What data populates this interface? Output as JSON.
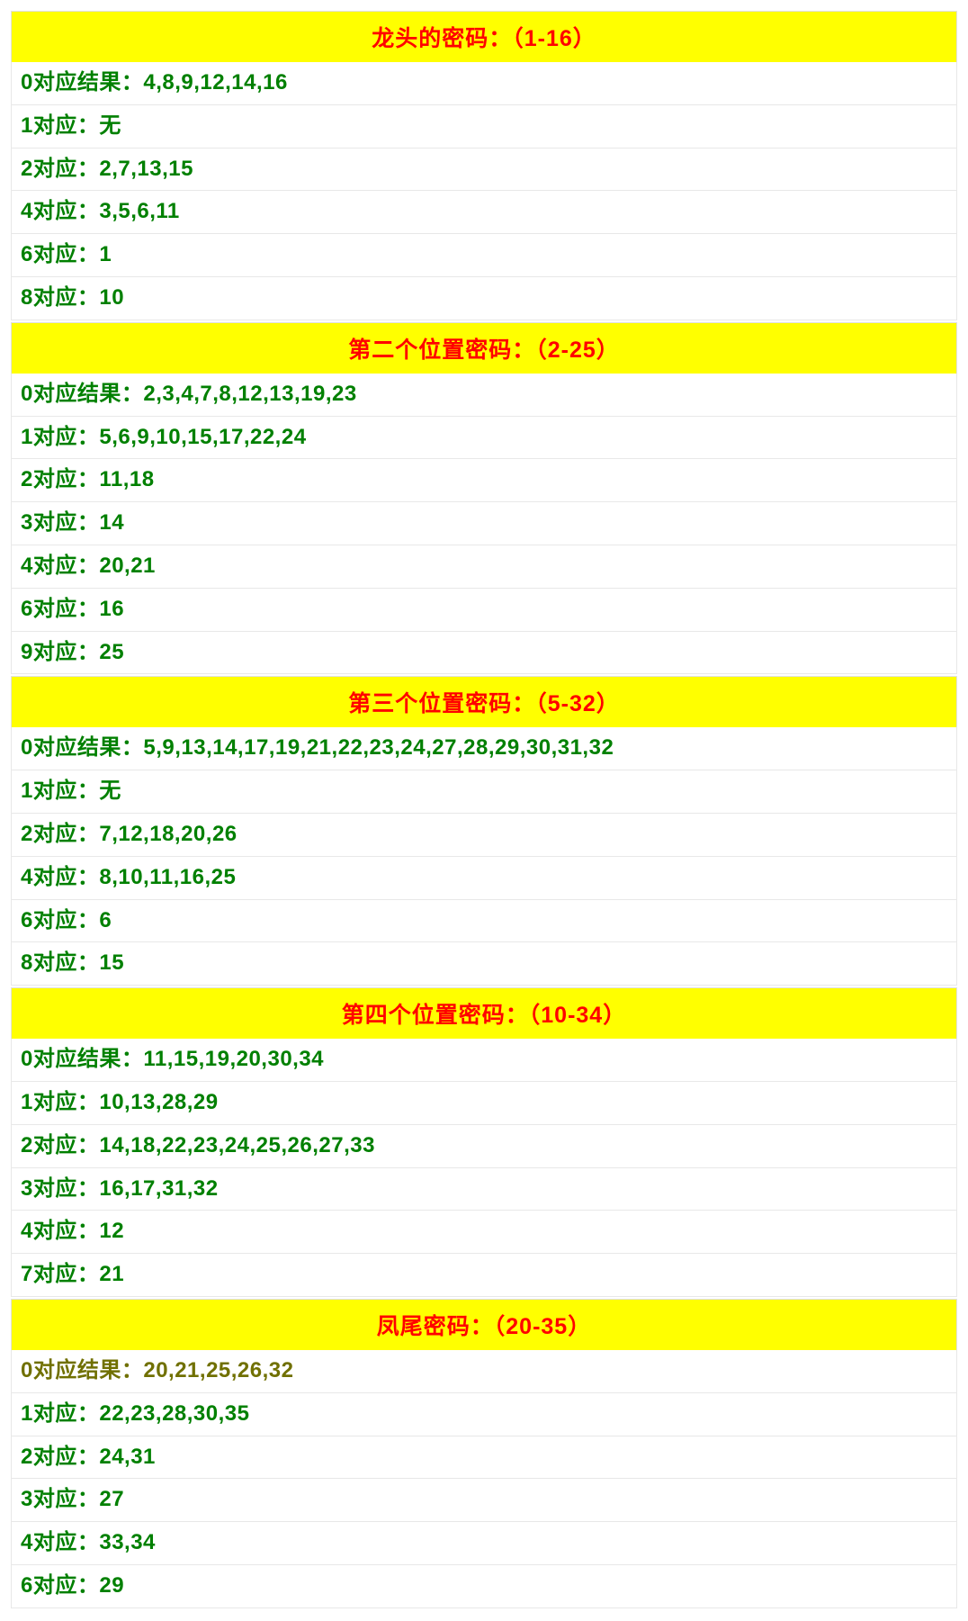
{
  "sections": [
    {
      "header": "龙头的密码：（1-16）",
      "rows": [
        "0对应结果：4,8,9,12,14,16",
        "1对应：无",
        "2对应：2,7,13,15",
        "4对应：3,5,6,11",
        "6对应：1",
        "8对应：10"
      ]
    },
    {
      "header": "第二个位置密码：（2-25）",
      "rows": [
        "0对应结果：2,3,4,7,8,12,13,19,23",
        "1对应：5,6,9,10,15,17,22,24",
        "2对应：11,18",
        "3对应：14",
        "4对应：20,21",
        "6对应：16",
        "9对应：25"
      ]
    },
    {
      "header": "第三个位置密码：（5-32）",
      "rows": [
        "0对应结果：5,9,13,14,17,19,21,22,23,24,27,28,29,30,31,32",
        "1对应：无",
        "2对应：7,12,18,20,26",
        "4对应：8,10,11,16,25",
        "6对应：6",
        "8对应：15"
      ]
    },
    {
      "header": "第四个位置密码：（10-34）",
      "rows": [
        "0对应结果：11,15,19,20,30,34",
        "1对应：10,13,28,29",
        "2对应：14,18,22,23,24,25,26,27,33",
        "3对应：16,17,31,32",
        "4对应：12",
        "7对应：21"
      ]
    },
    {
      "header": "凤尾密码：（20-35）",
      "rows": [
        "0对应结果：20,21,25,26,32",
        "1对应：22,23,28,30,35",
        "2对应：24,31",
        "3对应：27",
        "4对应：33,34",
        "6对应：29"
      ],
      "styleHints": {
        "oliveFirstRow": true
      }
    }
  ]
}
